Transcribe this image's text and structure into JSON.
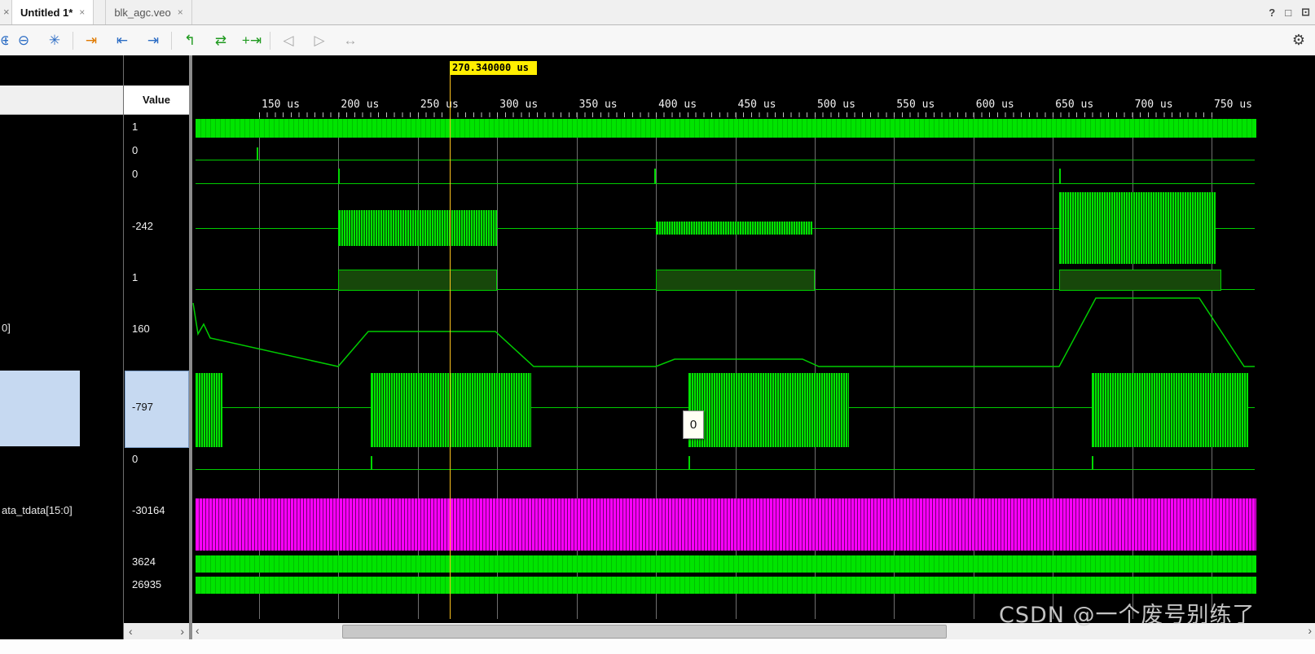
{
  "window": {
    "tabs": [
      {
        "label": "Untitled 1*"
      },
      {
        "label": "blk_agc.veo"
      }
    ],
    "close_glyph": "×",
    "icons": {
      "help": "?",
      "maximize": "□",
      "float": "⊡"
    }
  },
  "toolbar": {
    "icons": [
      {
        "name": "zoom-out",
        "glyph": "⊖"
      },
      {
        "name": "zoom-fit",
        "glyph": "✳"
      },
      {
        "name": "next-transition",
        "glyph": "⇥"
      },
      {
        "name": "go-to-start",
        "glyph": "⇤"
      },
      {
        "name": "go-to-end",
        "glyph": "⇥"
      },
      {
        "name": "previous-edge",
        "glyph": "↰"
      },
      {
        "name": "swap-edges",
        "glyph": "⇄"
      },
      {
        "name": "add-marker",
        "glyph": "+⇥"
      },
      {
        "name": "previous-marker",
        "glyph": "◁"
      },
      {
        "name": "next-marker",
        "glyph": "▷"
      },
      {
        "name": "marker-range",
        "glyph": "↔"
      },
      {
        "name": "settings",
        "glyph": "⚙"
      }
    ]
  },
  "cursor": {
    "label": "270.340000 us"
  },
  "timeline": {
    "ticks": [
      "150 us",
      "200 us",
      "250 us",
      "300 us",
      "350 us",
      "400 us",
      "450 us",
      "500 us",
      "550 us",
      "600 us",
      "650 us",
      "700 us",
      "750 us"
    ]
  },
  "grid": {
    "value_header": "Value"
  },
  "signals": [
    {
      "name": "",
      "value": "1"
    },
    {
      "name": "",
      "value": "0"
    },
    {
      "name": "",
      "value": "0"
    },
    {
      "name": "",
      "value": "-242"
    },
    {
      "name": "",
      "value": "1"
    },
    {
      "name": "0]",
      "value": "160"
    },
    {
      "name": "",
      "value": "-797"
    },
    {
      "name": "",
      "value": "0"
    },
    {
      "name": "ata_tdata[15:0]",
      "value": "-30164"
    },
    {
      "name": "",
      "value": "3624"
    },
    {
      "name": "",
      "value": "26935"
    }
  ],
  "tooltip": {
    "value": "0"
  },
  "scroll": {
    "left": "‹",
    "right": "›"
  },
  "watermark": "CSDN @一个废号别练了",
  "colors": {
    "wave_green": "#00e400",
    "wave_magenta": "#ff00ff",
    "cursor_yellow": "#ffc31e",
    "selection_blue": "#c6d9f1"
  }
}
